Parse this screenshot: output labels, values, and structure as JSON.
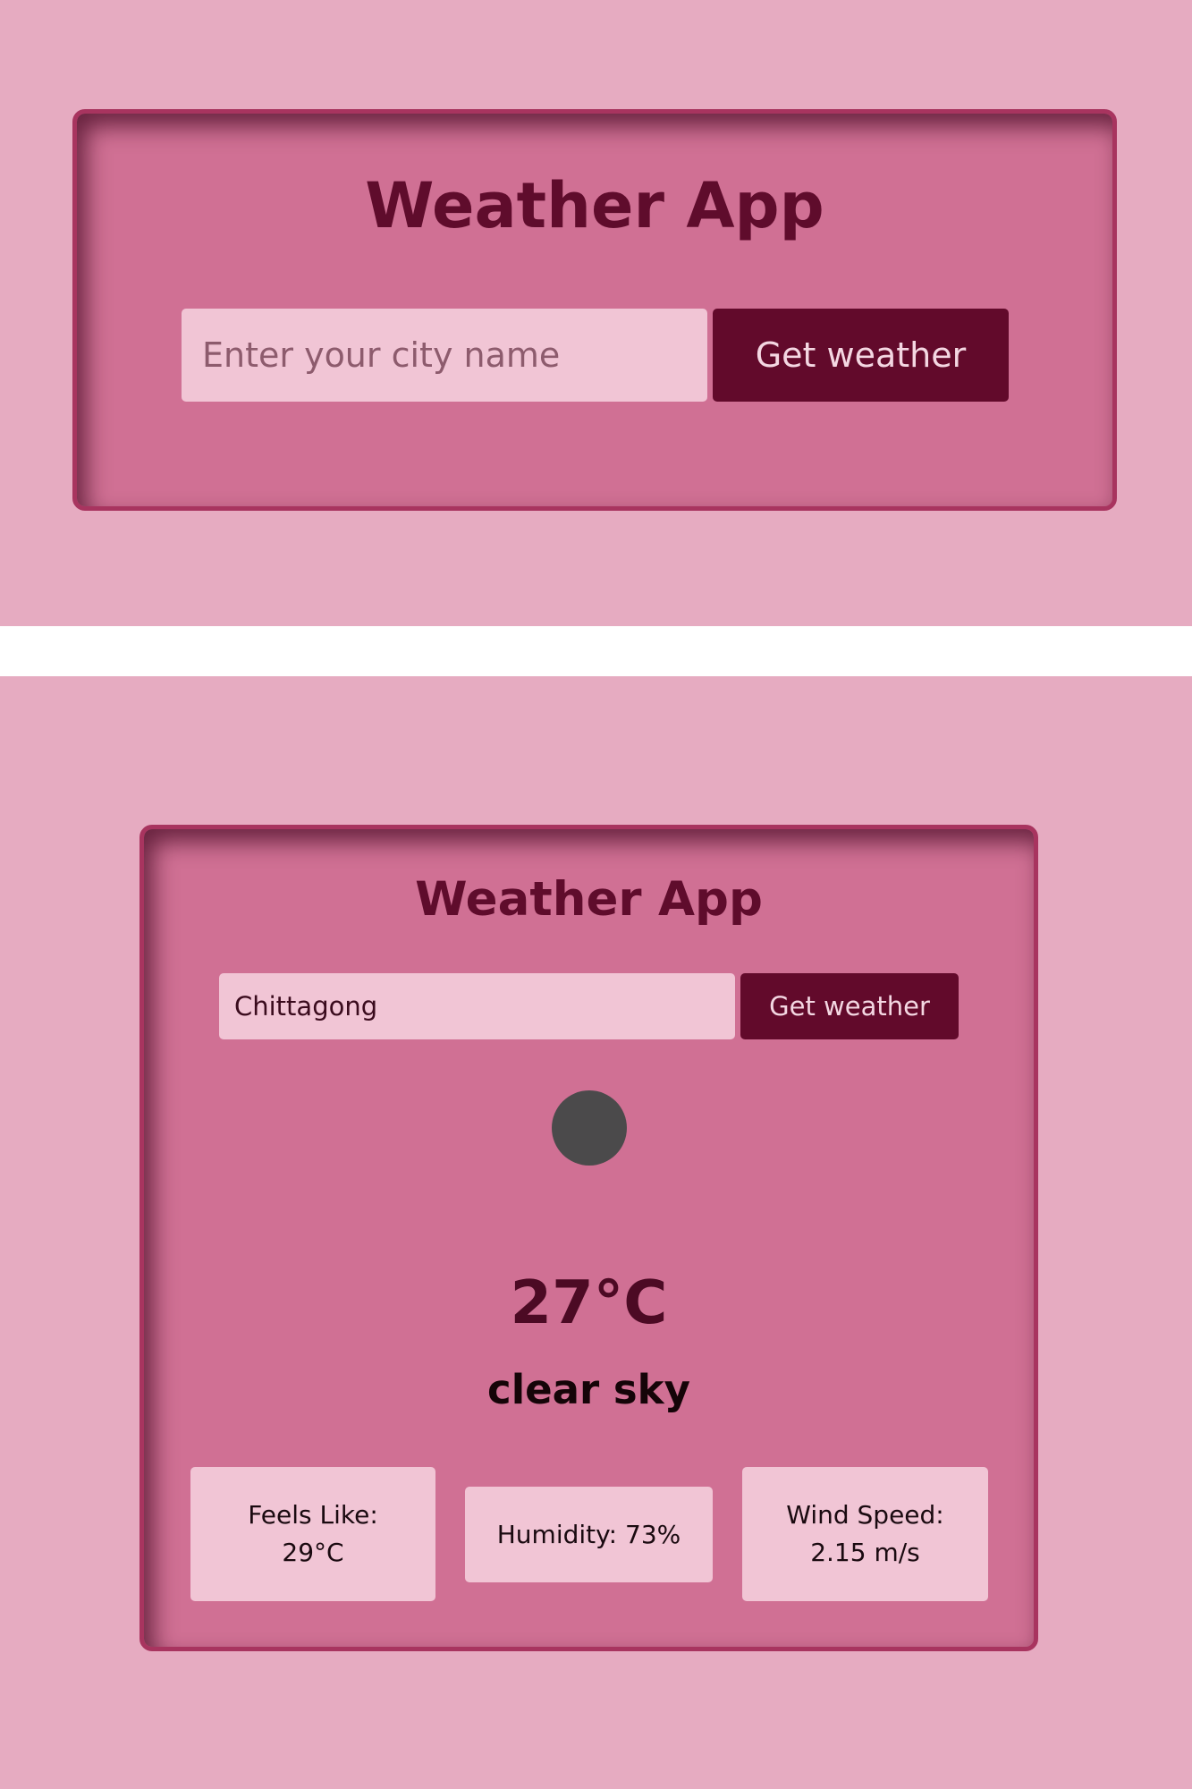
{
  "app": {
    "title": "Weather App",
    "search": {
      "placeholder": "Enter your city name",
      "button_label": "Get weather"
    }
  },
  "result": {
    "city_value": "Chittagong",
    "icon": "weather-condition-icon",
    "temperature": "27°C",
    "description": "clear sky",
    "details": {
      "feels_like_label": "Feels Like:",
      "feels_like_value": "29°C",
      "humidity": "Humidity: 73%",
      "wind_label": "Wind Speed:",
      "wind_value": "2.15 m/s"
    }
  },
  "colors": {
    "page_background": "#e6abc1",
    "card_background": "#d07094",
    "card_border": "#a8345f",
    "accent": "#620a2b",
    "input_background": "#f1c5d5"
  }
}
